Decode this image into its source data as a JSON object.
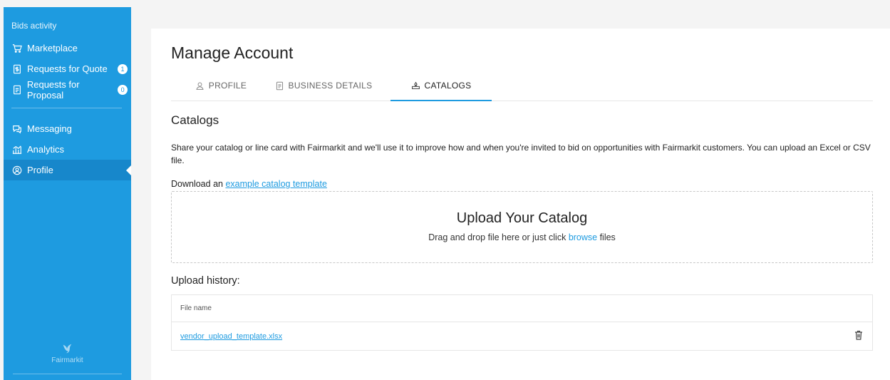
{
  "sidebar": {
    "section_label": "Bids activity",
    "items": [
      {
        "label": "Marketplace",
        "icon": "cart-icon",
        "badge": null
      },
      {
        "label": "Requests for Quote",
        "icon": "document-dollar-icon",
        "badge": "1"
      },
      {
        "label": "Requests for Proposal",
        "icon": "document-icon",
        "badge": "0"
      },
      {
        "label": "Messaging",
        "icon": "chat-icon",
        "badge": null
      },
      {
        "label": "Analytics",
        "icon": "analytics-icon",
        "badge": null
      },
      {
        "label": "Profile",
        "icon": "user-circle-icon",
        "badge": null,
        "active": true
      }
    ],
    "logo_text": "Fairmarkit"
  },
  "page": {
    "title": "Manage Account",
    "tabs": [
      {
        "label": "PROFILE",
        "icon": "user-icon"
      },
      {
        "label": "BUSINESS DETAILS",
        "icon": "document-icon"
      },
      {
        "label": "CATALOGS",
        "icon": "catalog-icon",
        "active": true
      }
    ]
  },
  "catalogs": {
    "title": "Catalogs",
    "description": "Share your catalog or line card with Fairmarkit and we'll use it to improve how and when you're invited to bid on opportunities with Fairmarkit customers. You can upload an Excel or CSV file.",
    "download_prefix": "Download an ",
    "download_link": "example catalog template",
    "upload_title": "Upload Your Catalog",
    "upload_sub_prefix": "Drag and drop file here or just click ",
    "upload_browse": "browse",
    "upload_sub_suffix": " files"
  },
  "history": {
    "title": "Upload history:",
    "column_header": "File name",
    "rows": [
      {
        "file_name": "vendor_upload_template.xlsx"
      }
    ]
  },
  "colors": {
    "accent": "#1e9be0",
    "sidebar_active": "#1787cb"
  }
}
